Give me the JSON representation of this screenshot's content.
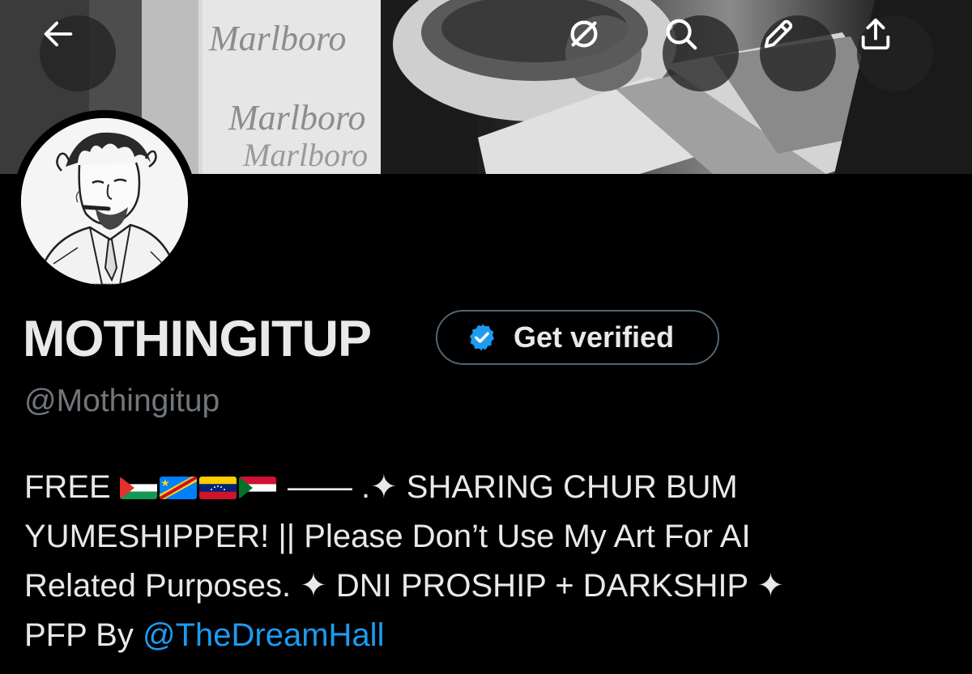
{
  "header": {
    "buttons": [
      {
        "name": "back",
        "icon": "arrow-left-icon"
      },
      {
        "name": "grok",
        "icon": "grok-icon"
      },
      {
        "name": "search",
        "icon": "search-icon"
      },
      {
        "name": "edit",
        "icon": "pencil-icon"
      },
      {
        "name": "share",
        "icon": "share-icon"
      }
    ]
  },
  "banner": {
    "texts": [
      "Marlboro",
      "Marlboro",
      "Marlboro"
    ]
  },
  "profile": {
    "display_name": "MOTHINGITUP",
    "verify_label": "Get verified",
    "handle": "@Mothingitup",
    "bio": {
      "line1_prefix": "FREE",
      "flags": [
        "palestine-flag",
        "dr-congo-flag",
        "venezuela-flag",
        "sudan-flag"
      ],
      "line1_suffix": "——  .✦ SHARING CHUR BUM",
      "line2": "YUMESHIPPER! || Please Don’t Use My Art For AI",
      "line3": "Related Purposes. ✦ DNI PROSHIP + DARKSHIP ✦",
      "line4_prefix": "PFP By",
      "mention": "@TheDreamHall"
    }
  },
  "colors": {
    "background": "#000000",
    "text_primary": "#e7e9ea",
    "text_secondary": "#71767b",
    "link": "#1d9bf0",
    "verified_badge": "#1d9bf0",
    "pill_border": "#536471"
  }
}
